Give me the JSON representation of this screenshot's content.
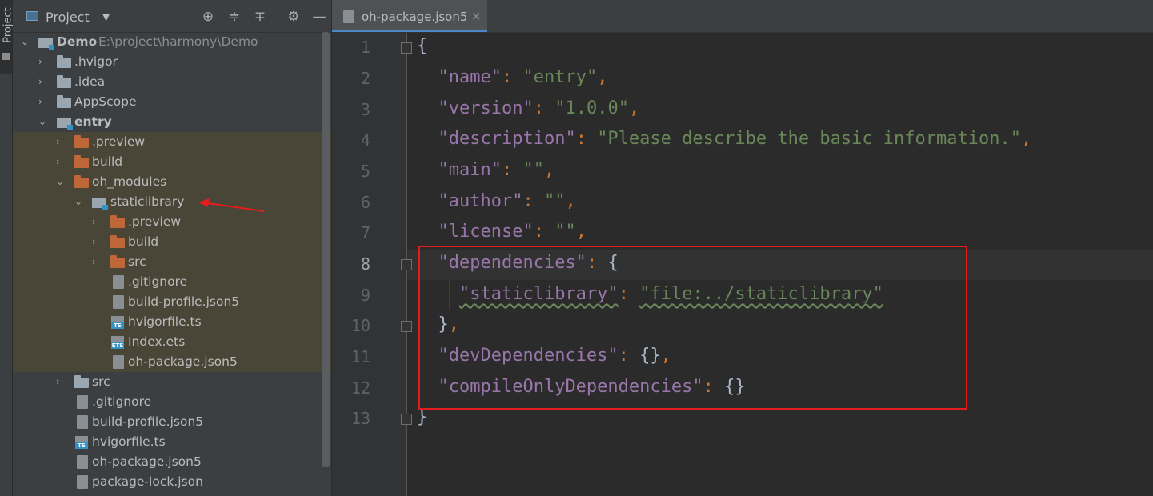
{
  "side_strip": {
    "tab_label": "Project"
  },
  "panel": {
    "title": "Project",
    "tools": [
      "locate-icon",
      "expand-all-icon",
      "collapse-all-icon",
      "gear-icon",
      "minimize-icon"
    ]
  },
  "tree": [
    {
      "label": "Demo",
      "hint": "E:\\project\\harmony\\Demo",
      "icon": "module-icon",
      "expanded": true
    },
    {
      "label": ".hvigor",
      "icon": "folder-icon"
    },
    {
      "label": ".idea",
      "icon": "folder-icon"
    },
    {
      "label": "AppScope",
      "icon": "folder-icon"
    },
    {
      "label": "entry",
      "icon": "module-icon",
      "expanded": true
    },
    {
      "label": ".preview",
      "icon": "folder-icon"
    },
    {
      "label": "build",
      "icon": "folder-icon"
    },
    {
      "label": "oh_modules",
      "icon": "folder-icon",
      "expanded": true
    },
    {
      "label": "staticlibrary",
      "icon": "module-icon",
      "expanded": true
    },
    {
      "label": ".preview",
      "icon": "folder-icon"
    },
    {
      "label": "build",
      "icon": "folder-icon"
    },
    {
      "label": "src",
      "icon": "folder-icon"
    },
    {
      "label": ".gitignore",
      "icon": "file-icon"
    },
    {
      "label": "build-profile.json5",
      "icon": "json-icon"
    },
    {
      "label": "hvigorfile.ts",
      "icon": "ts-icon"
    },
    {
      "label": "Index.ets",
      "icon": "ets-icon"
    },
    {
      "label": "oh-package.json5",
      "icon": "json-icon"
    },
    {
      "label": "src",
      "icon": "folder-icon"
    },
    {
      "label": ".gitignore",
      "icon": "file-icon"
    },
    {
      "label": "build-profile.json5",
      "icon": "json-icon"
    },
    {
      "label": "hvigorfile.ts",
      "icon": "ts-icon"
    },
    {
      "label": "oh-package.json5",
      "icon": "json-icon"
    },
    {
      "label": "package-lock.json",
      "icon": "json-icon"
    }
  ],
  "editor": {
    "tab_label": "oh-package.json5",
    "tab_close": "×",
    "line_numbers": [
      "1",
      "2",
      "3",
      "4",
      "5",
      "6",
      "7",
      "8",
      "9",
      "10",
      "11",
      "12",
      "13"
    ],
    "active_line": "8",
    "code": {
      "l1_brace": "{",
      "l2_key": "\"name\"",
      "l2_val": "\"entry\"",
      "l3_key": "\"version\"",
      "l3_val": "\"1.0.0\"",
      "l4_key": "\"description\"",
      "l4_val": "\"Please describe the basic information.\"",
      "l5_key": "\"main\"",
      "l5_val": "\"\"",
      "l6_key": "\"author\"",
      "l6_val": "\"\"",
      "l7_key": "\"license\"",
      "l7_val": "\"\"",
      "l8_key": "\"dependencies\"",
      "l8_brace": "{",
      "l9_key": "\"staticlibrary\"",
      "l9_val": "\"file:../staticlibrary\"",
      "l10_brace": "}",
      "l11_key": "\"devDependencies\"",
      "l11_val": "{}",
      "l12_key": "\"compileOnlyDependencies\"",
      "l12_val": "{}",
      "l13_brace": "}",
      "colon": ": ",
      "comma": ","
    }
  },
  "colors": {
    "annotation_red": "#e31d1d",
    "accent_blue": "#4a88c7"
  }
}
